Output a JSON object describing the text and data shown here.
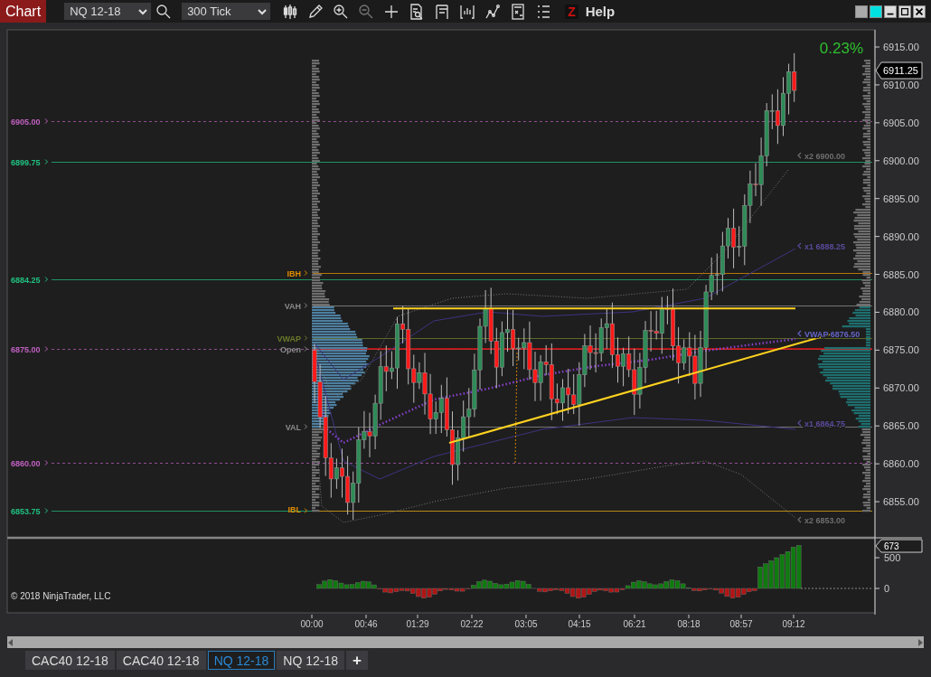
{
  "toolbar": {
    "title": "Chart",
    "instrument": "NQ 12-18",
    "interval": "300 Tick",
    "z_label": "Z",
    "help": "Help"
  },
  "chart": {
    "change": "0.23%",
    "copyright": "© 2018 NinjaTrader, LLC",
    "last_price": "6911.25",
    "price_axis": [
      "6915.00",
      "6910.00",
      "6905.00",
      "6900.00",
      "6895.00",
      "6890.00",
      "6885.00",
      "6880.00",
      "6875.00",
      "6870.00",
      "6865.00",
      "6860.00",
      "6855.00"
    ],
    "levels": [
      {
        "label": "6905.00",
        "color": "#c060c0",
        "kind": "dashed"
      },
      {
        "label": "6899.75",
        "color": "#20c080",
        "kind": "solid"
      },
      {
        "label": "6884.25",
        "color": "#20c080",
        "kind": "solid"
      },
      {
        "label": "6875.00",
        "color": "#c060c0",
        "kind": "dashed"
      },
      {
        "label": "6860.00",
        "color": "#c060c0",
        "kind": "dashed"
      },
      {
        "label": "6853.75",
        "color": "#20c080",
        "kind": "solid"
      }
    ],
    "profile_labels": [
      {
        "label": "IBH",
        "color": "#e08a00"
      },
      {
        "label": "VAH",
        "color": "#8a8a8a"
      },
      {
        "label": "VWAP",
        "color": "#6b7a2a"
      },
      {
        "label": "Open",
        "color": "#8a8a8a"
      },
      {
        "label": "VAL",
        "color": "#8a8a8a"
      },
      {
        "label": "IBL",
        "color": "#e08a00"
      }
    ],
    "annotations": [
      {
        "label": "x2 6900.00",
        "color": "#6e6e6e"
      },
      {
        "label": "x1 6888.25",
        "color": "#5a4a9a"
      },
      {
        "label": "VWAP 6876.50",
        "color": "#6464c8"
      },
      {
        "label": "x1 6864.75",
        "color": "#5a4a9a"
      },
      {
        "label": "x2 6853.00",
        "color": "#6e6e6e"
      }
    ],
    "volume_axis": [
      "500",
      "0"
    ],
    "volume_last": "673",
    "time_axis": [
      "00:00",
      "00:46",
      "01:29",
      "02:22",
      "03:05",
      "04:15",
      "06:21",
      "08:18",
      "08:57",
      "09:12"
    ]
  },
  "tabs": [
    {
      "label": "CAC40 12-18",
      "selected": false
    },
    {
      "label": "CAC40 12-18",
      "selected": false
    },
    {
      "label": "NQ 12-18",
      "selected": true
    },
    {
      "label": "NQ 12-18",
      "selected": false
    }
  ],
  "add_tab": "+"
}
